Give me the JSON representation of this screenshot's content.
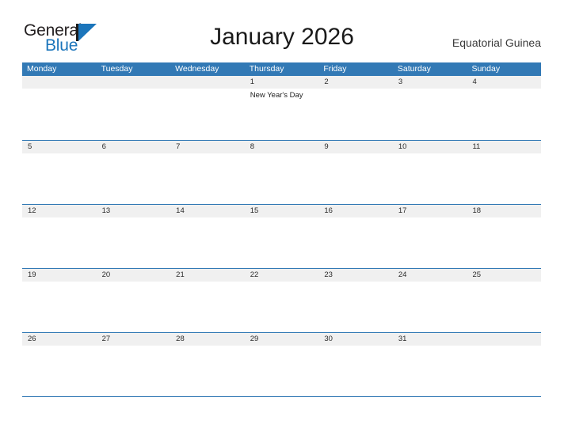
{
  "brand": {
    "logo_text_top": "General",
    "logo_text_bottom": "Blue",
    "logo_mark_icon": "flag-triangle-icon",
    "accent_color": "#1b75bb"
  },
  "header": {
    "title": "January 2026",
    "region": "Equatorial Guinea"
  },
  "calendar": {
    "header_bg_color": "#3279b5",
    "daynum_band_color": "#f0f0f0",
    "weekdays": [
      "Monday",
      "Tuesday",
      "Wednesday",
      "Thursday",
      "Friday",
      "Saturday",
      "Sunday"
    ],
    "weeks": [
      [
        {
          "day": "",
          "events": []
        },
        {
          "day": "",
          "events": []
        },
        {
          "day": "",
          "events": []
        },
        {
          "day": "1",
          "events": [
            "New Year's Day"
          ]
        },
        {
          "day": "2",
          "events": []
        },
        {
          "day": "3",
          "events": []
        },
        {
          "day": "4",
          "events": []
        }
      ],
      [
        {
          "day": "5",
          "events": []
        },
        {
          "day": "6",
          "events": []
        },
        {
          "day": "7",
          "events": []
        },
        {
          "day": "8",
          "events": []
        },
        {
          "day": "9",
          "events": []
        },
        {
          "day": "10",
          "events": []
        },
        {
          "day": "11",
          "events": []
        }
      ],
      [
        {
          "day": "12",
          "events": []
        },
        {
          "day": "13",
          "events": []
        },
        {
          "day": "14",
          "events": []
        },
        {
          "day": "15",
          "events": []
        },
        {
          "day": "16",
          "events": []
        },
        {
          "day": "17",
          "events": []
        },
        {
          "day": "18",
          "events": []
        }
      ],
      [
        {
          "day": "19",
          "events": []
        },
        {
          "day": "20",
          "events": []
        },
        {
          "day": "21",
          "events": []
        },
        {
          "day": "22",
          "events": []
        },
        {
          "day": "23",
          "events": []
        },
        {
          "day": "24",
          "events": []
        },
        {
          "day": "25",
          "events": []
        }
      ],
      [
        {
          "day": "26",
          "events": []
        },
        {
          "day": "27",
          "events": []
        },
        {
          "day": "28",
          "events": []
        },
        {
          "day": "29",
          "events": []
        },
        {
          "day": "30",
          "events": []
        },
        {
          "day": "31",
          "events": []
        },
        {
          "day": "",
          "events": []
        }
      ]
    ]
  }
}
